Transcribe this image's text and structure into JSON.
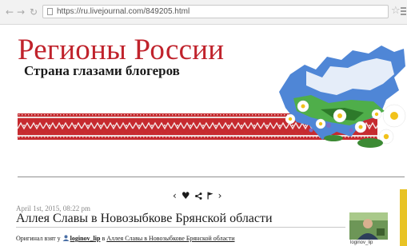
{
  "browser": {
    "url": "https://ru.livejournal.com/849205.html",
    "icons": {
      "back": "back-arrow-icon",
      "forward": "forward-arrow-icon",
      "reload": "reload-icon",
      "bookmark": "star-icon",
      "menu": "hamburger-menu-icon"
    }
  },
  "site": {
    "title": "Регионы России",
    "subtitle": "Страна глазами блогеров"
  },
  "post_controls": {
    "prev": "‹",
    "like": "♥",
    "share": "share-icon",
    "flag": "flag-icon",
    "next": "›"
  },
  "post": {
    "date": "April 1st, 2015, 08:22 pm",
    "title": "Аллея Славы в Новозыбкове Брянской области",
    "source_prefix": "Оригинал взят у",
    "author": "loginov_lip",
    "source_in": "в",
    "source_link": "Аллея Славы в Новозыбкове Брянской области"
  },
  "sidebar": {
    "author_label": "loginov_lip"
  },
  "colors": {
    "title_red": "#c0232c",
    "ornament_red": "#c62a2f",
    "side_strip": "#e8c326"
  }
}
